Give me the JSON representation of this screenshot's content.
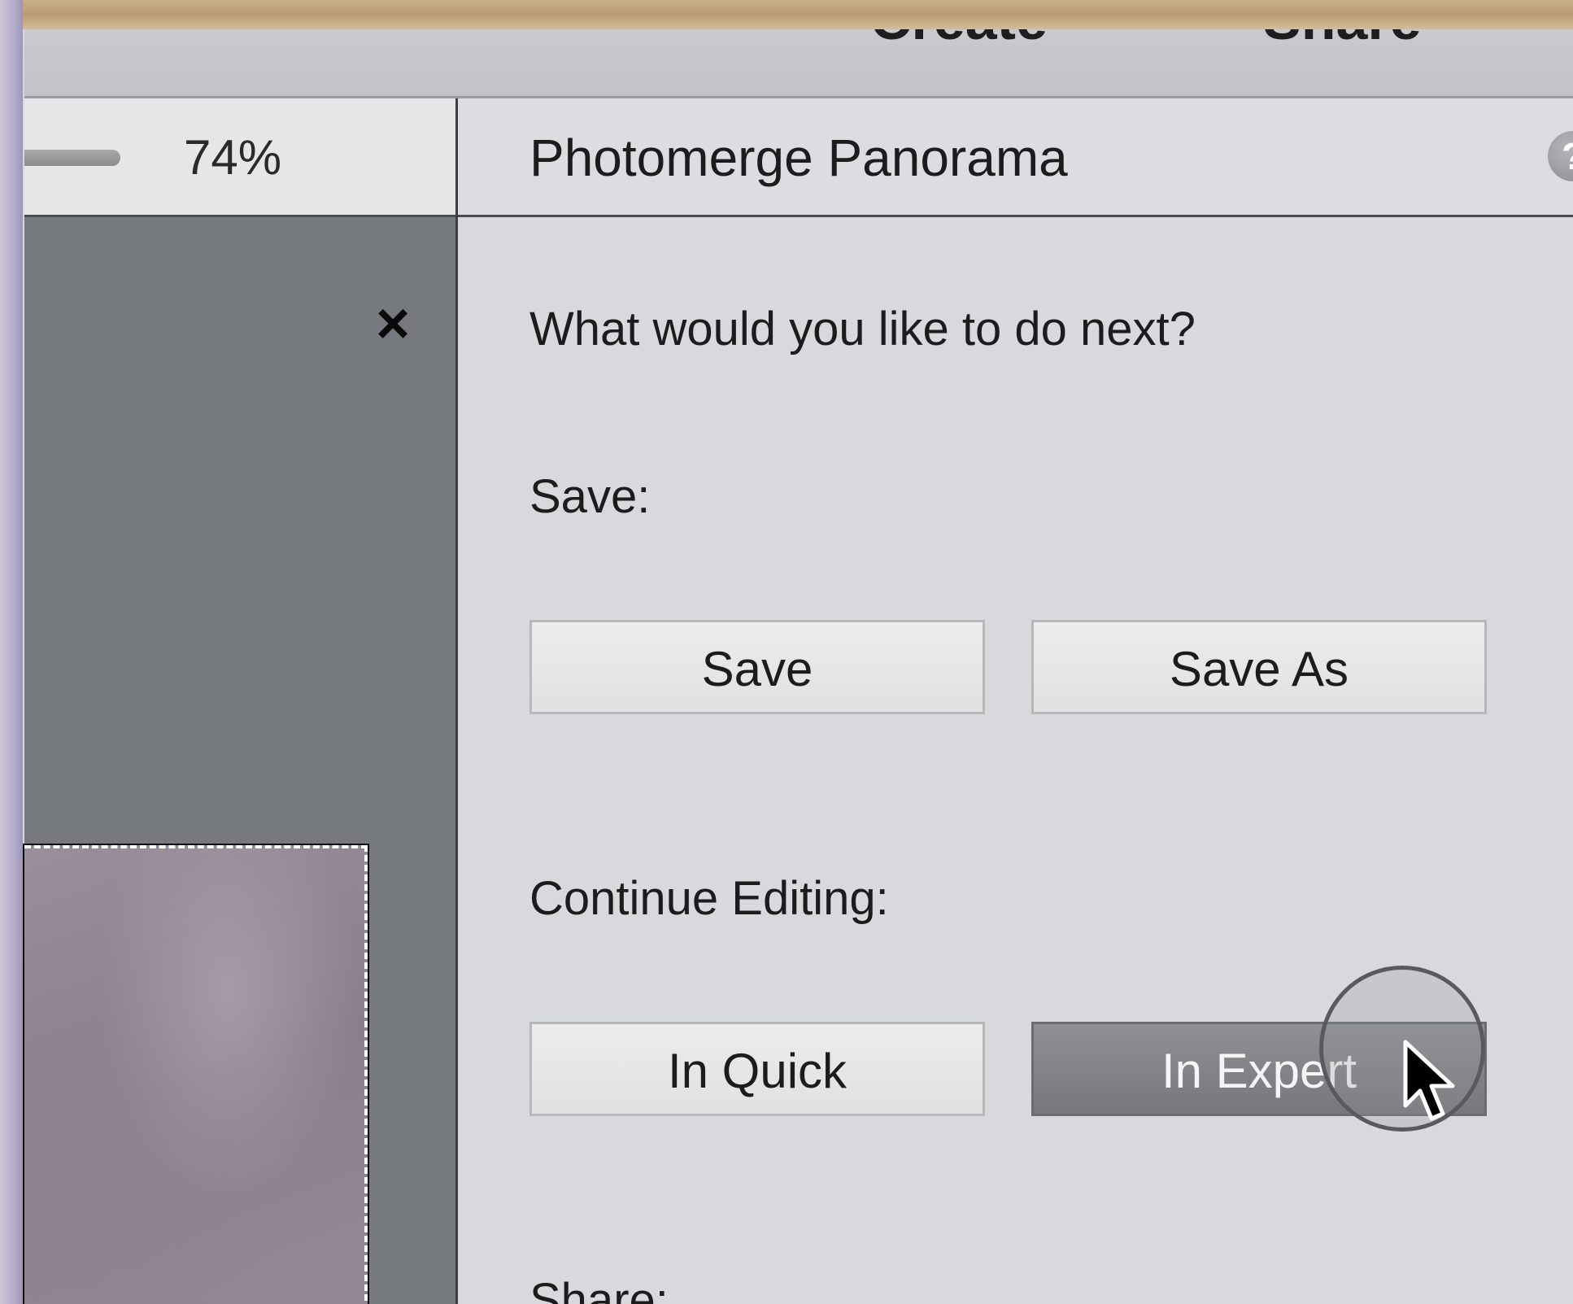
{
  "menu": {
    "create_label": "Create",
    "share_label": "Share"
  },
  "canvas": {
    "zoom_percent": "74%",
    "close_icon": "×"
  },
  "panel": {
    "title": "Photomerge Panorama",
    "help_icon": "?",
    "prompt": "What would you like to do next?",
    "save_section": {
      "label": "Save:",
      "buttons": [
        "Save",
        "Save As"
      ]
    },
    "continue_section": {
      "label": "Continue Editing:",
      "buttons": [
        "In Quick",
        "In Expert"
      ]
    },
    "share_section": {
      "label": "Share:"
    }
  },
  "colors": {
    "panel_bg": "#d8d9dd",
    "canvas_bg": "#767a7f",
    "active_button": "#808286"
  }
}
